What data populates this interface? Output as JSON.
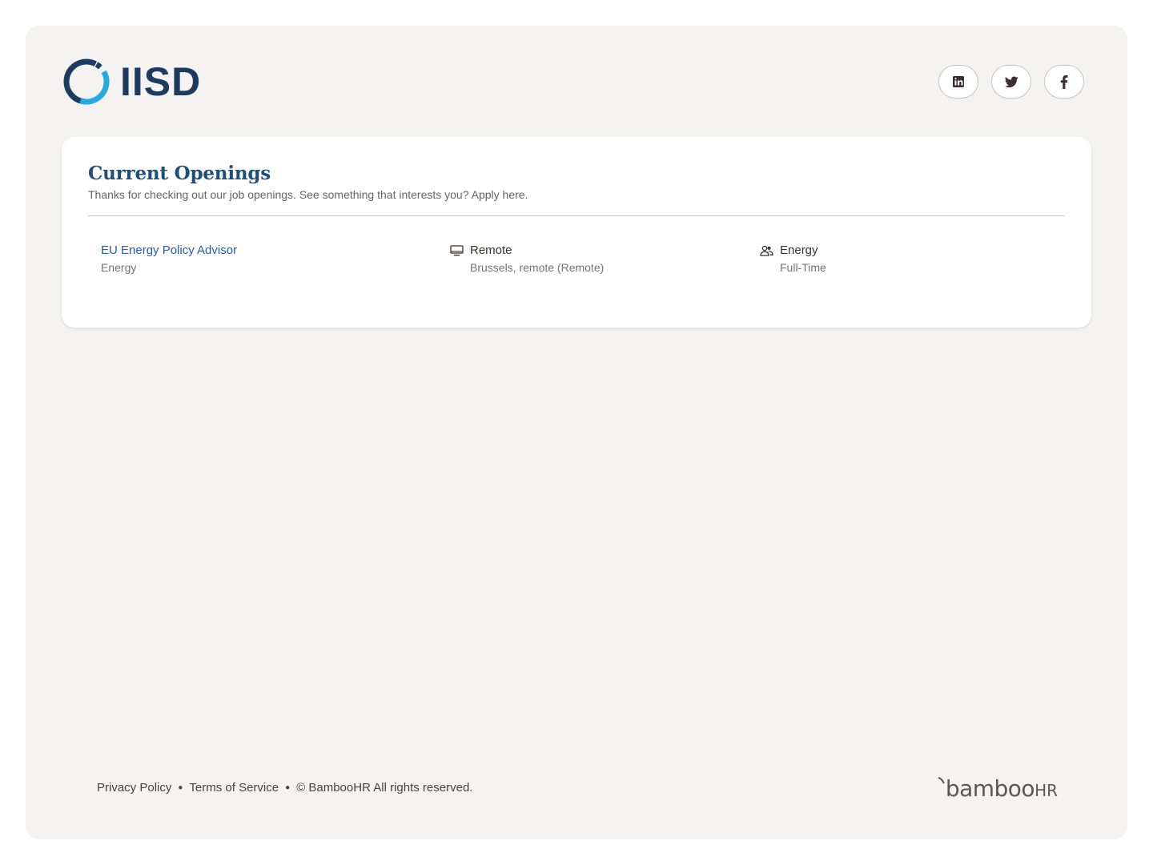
{
  "brand": {
    "name": "IISD",
    "ring_dark": "#1f3a5f",
    "ring_light": "#29a9e0"
  },
  "socials": [
    {
      "name": "linkedin",
      "icon": "linkedin-icon"
    },
    {
      "name": "twitter",
      "icon": "twitter-icon"
    },
    {
      "name": "facebook",
      "icon": "facebook-icon"
    }
  ],
  "openings": {
    "title": "Current Openings",
    "subtitle": "Thanks for checking out our job openings. See something that interests you? Apply here.",
    "jobs": [
      {
        "title": "EU Energy Policy Advisor",
        "department": "Energy",
        "location_type": "Remote",
        "location": "Brussels, remote (Remote)",
        "team": "Energy",
        "employment_type": "Full-Time"
      }
    ]
  },
  "footer": {
    "privacy": "Privacy Policy",
    "terms": "Terms of Service",
    "copyright": "© BambooHR All rights reserved.",
    "brand_main": "bamboo",
    "brand_hr": "HR"
  },
  "colors": {
    "accent": "#1f4e79",
    "link": "#2a5aa8",
    "background": "#f5f3f1"
  }
}
